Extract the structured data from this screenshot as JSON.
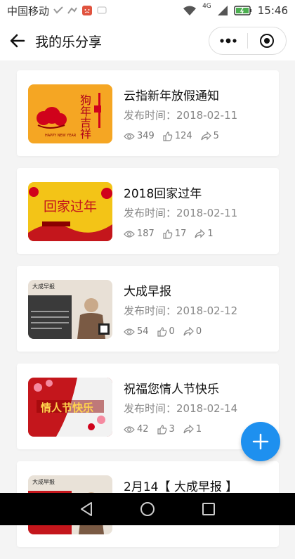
{
  "status_bar": {
    "carrier": "中国移动",
    "time": "15:46",
    "network": "4G"
  },
  "header": {
    "title": "我的乐分享"
  },
  "posts": [
    {
      "title": "云指新年放假通知",
      "date": "发布时间：2018-02-11",
      "views": "349",
      "likes": "124",
      "shares": "5",
      "thumb_theme": "orange",
      "thumb_text": "狗年吉祥"
    },
    {
      "title": "2018回家过年",
      "date": "发布时间：2018-02-11",
      "views": "187",
      "likes": "17",
      "shares": "1",
      "thumb_theme": "yellow",
      "thumb_text": "回家过年"
    },
    {
      "title": "大成早报",
      "date": "发布时间：2018-02-12",
      "views": "54",
      "likes": "0",
      "shares": "0",
      "thumb_theme": "photo",
      "thumb_text": "大成早报"
    },
    {
      "title": "祝福您情人节快乐",
      "date": "发布时间：2018-02-14",
      "views": "42",
      "likes": "3",
      "shares": "1",
      "thumb_theme": "red",
      "thumb_text": "情人节快乐"
    },
    {
      "title": "2月14【 大成早报 】",
      "date": "",
      "views": "",
      "likes": "",
      "shares": "",
      "thumb_theme": "photo2",
      "thumb_text": "大成早报"
    }
  ],
  "colors": {
    "accent": "#1e90ef",
    "thumb_orange": "#f5a623",
    "thumb_yellow": "#f3c417",
    "thumb_red": "#c4161c"
  }
}
